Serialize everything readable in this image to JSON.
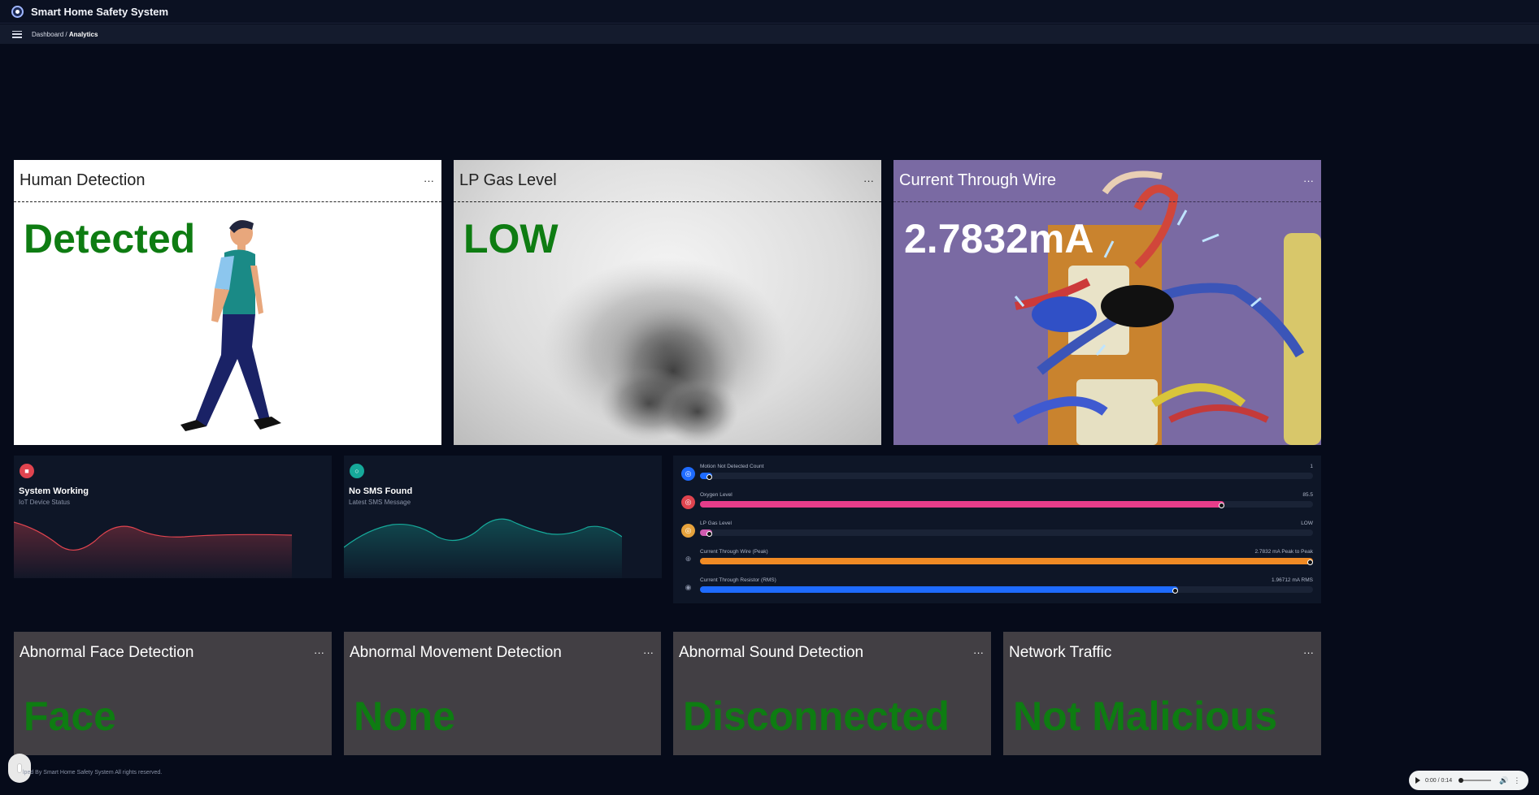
{
  "app": {
    "title": "Smart Home Safety System"
  },
  "breadcrumb": {
    "parent": "Dashboard /",
    "current": "Analytics"
  },
  "cards": {
    "human": {
      "title": "Human Detection",
      "value": "Detected"
    },
    "gas": {
      "title": "LP Gas Level",
      "value": "LOW"
    },
    "wire": {
      "title": "Current Through Wire",
      "value": "2.7832mA"
    }
  },
  "mini": [
    {
      "title": "System Working",
      "subtitle": "IoT Device Status",
      "color": "#e0444f",
      "icon": "camera-icon"
    },
    {
      "title": "No SMS Found",
      "subtitle": "Latest SMS Message",
      "color": "#16a99a",
      "icon": "message-icon"
    }
  ],
  "progress": [
    {
      "label": "Motion Not Detected Count",
      "value": "1",
      "percent": 1,
      "color": "#1e6bff",
      "icon_color": "#1e6bff",
      "icon": "motion-icon"
    },
    {
      "label": "Oxygen Level",
      "value": "85.5",
      "percent": 85.5,
      "color": "#e63d8a",
      "icon_color": "#e0444f",
      "icon": "oxygen-icon"
    },
    {
      "label": "LP Gas Level",
      "value": "LOW",
      "percent": 1,
      "color": "#d05bb0",
      "icon_color": "#e6a23c",
      "icon": "gas-icon"
    },
    {
      "label": "Current Through Wire (Peak)",
      "value": "2.7832 mA Peak to Peak",
      "percent": 100,
      "color": "#f08a24",
      "icon_color": "#0e1627",
      "icon": "globe-icon"
    },
    {
      "label": "Current Through Resistor (RMS)",
      "value": "1.96712 mA RMS",
      "percent": 78,
      "color": "#1e6bff",
      "icon_color": "#0e1627",
      "icon": "target-icon"
    }
  ],
  "detections": [
    {
      "title": "Abnormal Face Detection",
      "value": "Face"
    },
    {
      "title": "Abnormal Movement Detection",
      "value": "None"
    },
    {
      "title": "Abnormal Sound Detection",
      "value": "Disconnected"
    },
    {
      "title": "Network Traffic",
      "value": "Not Malicious"
    }
  ],
  "footer": {
    "text": "lped By Smart Home Safety System All rights reserved."
  },
  "audio": {
    "time": "0:00 / 0:14"
  }
}
